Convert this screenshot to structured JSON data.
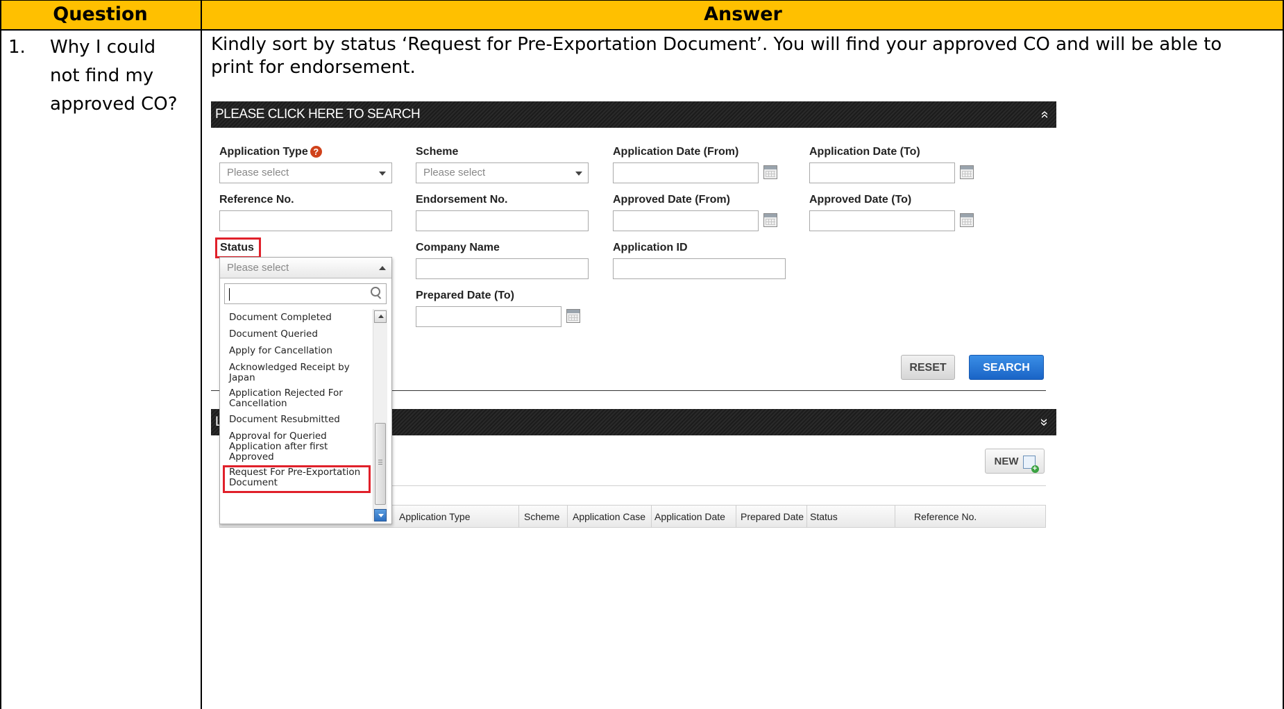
{
  "table": {
    "header_question": "Question",
    "header_answer": "Answer",
    "row1": {
      "number": "1.",
      "question_line1": "Why I could",
      "question_line2": "not find my",
      "question_line3": "approved CO?",
      "answer_line1": "Kindly sort by status ‘Request for Pre-Exportation Document’. You will find your approved CO and will be able to",
      "answer_line2": "print for endorsement."
    }
  },
  "screenshot": {
    "search_panel_title": "PLEASE CLICK HERE TO SEARCH",
    "collapse_glyph": "»",
    "labels": {
      "application_type": "Application Type",
      "scheme": "Scheme",
      "application_date_from": "Application Date (From)",
      "application_date_to": "Application Date (To)",
      "reference_no": "Reference No.",
      "endorsement_no": "Endorsement No.",
      "approved_date_from": "Approved Date (From)",
      "approved_date_to": "Approved Date (To)",
      "status": "Status",
      "company_name": "Company Name",
      "application_id": "Application ID",
      "prepared_date_to": "Prepared Date (To)"
    },
    "help_glyph": "?",
    "select_placeholder": "Please select",
    "status_dropdown": {
      "selected": "Please select",
      "search_value": "",
      "options": [
        "Document Completed",
        "Document Queried",
        "Apply for Cancellation",
        "Acknowledged Receipt by Japan",
        "Application Rejected For Cancellation",
        "Document Resubmitted",
        "Approval for Queried Application after first Approved",
        "Request For Pre-Exportation Document"
      ],
      "highlighted_option": "Request For Pre-Exportation Document"
    },
    "buttons": {
      "reset": "RESET",
      "search": "SEARCH",
      "new": "NEW"
    },
    "list_panel_title_visible": "L",
    "grid_columns": [
      "Application Type",
      "Scheme",
      "Application Case",
      "Application Date",
      "Prepared Date",
      "Status",
      "Reference No."
    ],
    "colors": {
      "header_bg": "#ffc000",
      "highlight_border": "#e0202a",
      "search_button": "#1a64c6"
    }
  }
}
